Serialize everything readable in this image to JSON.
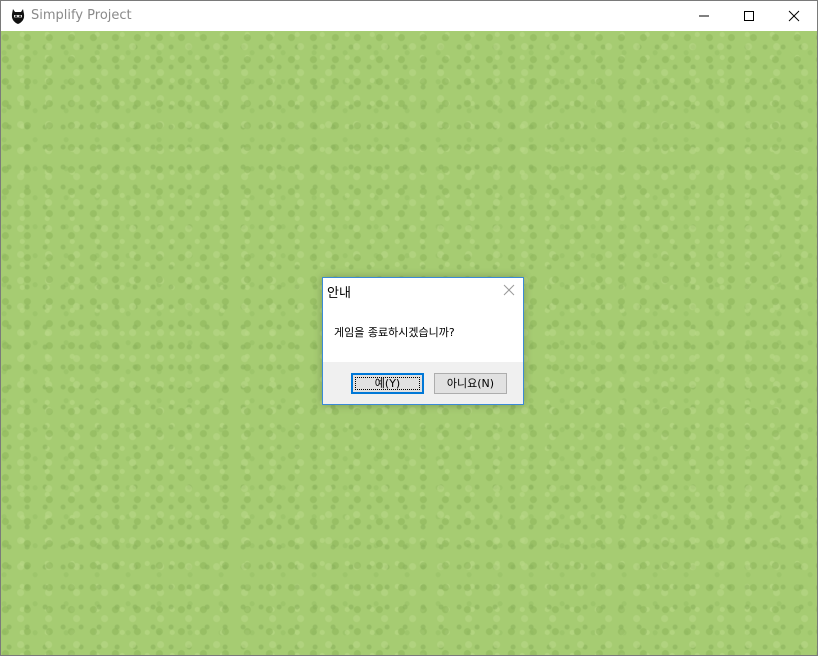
{
  "window": {
    "title": "Simplify Project",
    "icon": "ninja-head-icon"
  },
  "dialog": {
    "title": "안내",
    "message": "게임을 종료하시겠습니까?",
    "yes_label": "예(Y)",
    "no_label": "아니요(N)"
  },
  "colors": {
    "grass": "#a6cc72",
    "dialog_border": "#3b8ad6",
    "footer": "#f0f0f0",
    "focus": "#0078d7"
  }
}
